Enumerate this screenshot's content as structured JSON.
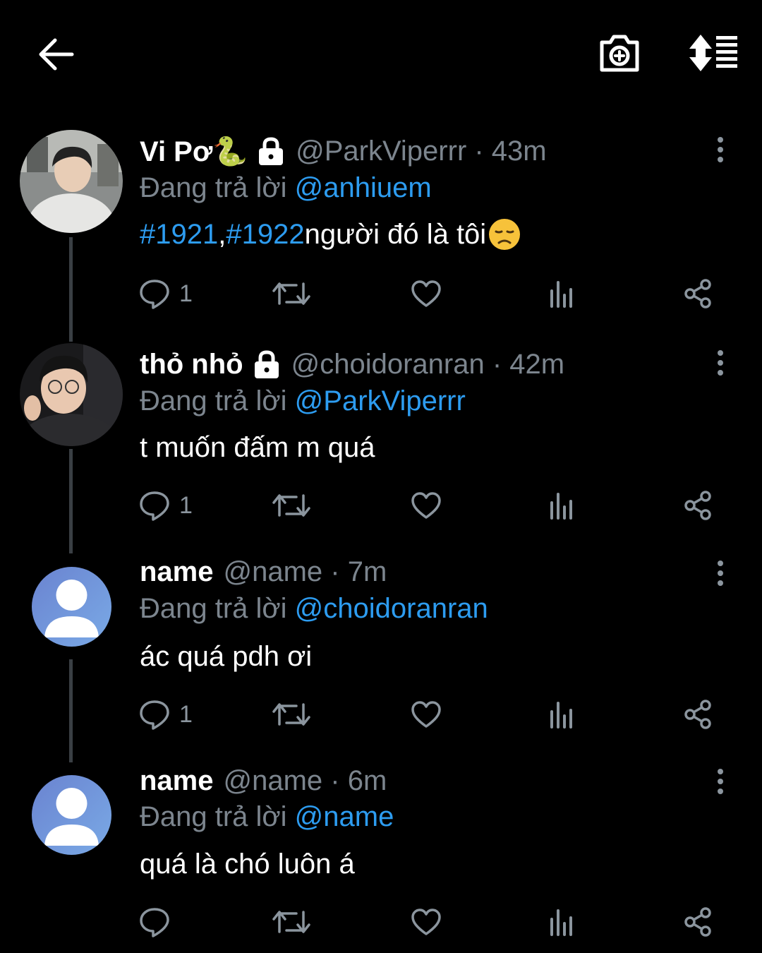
{
  "colors": {
    "background": "#000000",
    "accent": "#2d9cf0",
    "secondary_text": "#7c858e",
    "icon": "#8b959e"
  },
  "topbar": {
    "back_icon": "arrow-left-icon",
    "camera_icon": "camera-plus-icon",
    "sort_icon": "sort-icon"
  },
  "tweets": [
    {
      "name": "Vi Pơ🐍",
      "locked": true,
      "meta": "@ParkViperrr · 43m",
      "reply_prefix": "Đang trả lời ",
      "reply_to": "@anhiuem",
      "text_parts": [
        {
          "t": "#1921",
          "tag": true
        },
        {
          "t": ",",
          "tag": false
        },
        {
          "t": "#1922",
          "tag": true
        },
        {
          "t": " người đó là tôi",
          "tag": false
        }
      ],
      "emoji": "😞",
      "reply_count": "1"
    },
    {
      "name": "thỏ nhỏ",
      "locked": true,
      "meta": "@choidoranran · 42m",
      "reply_prefix": "Đang trả lời ",
      "reply_to": "@ParkViperrr",
      "text": "t muốn đấm m quá",
      "reply_count": "1"
    },
    {
      "name": "name",
      "locked": false,
      "meta": "@name · 7m",
      "reply_prefix": "Đang trả lời ",
      "reply_to": "@choidoranran",
      "text": "ác quá pdh ơi",
      "reply_count": "1"
    },
    {
      "name": "name",
      "locked": false,
      "meta": "@name · 6m",
      "reply_prefix": "Đang trả lời ",
      "reply_to": "@name",
      "text": "quá là chó luôn á",
      "reply_count": ""
    }
  ]
}
